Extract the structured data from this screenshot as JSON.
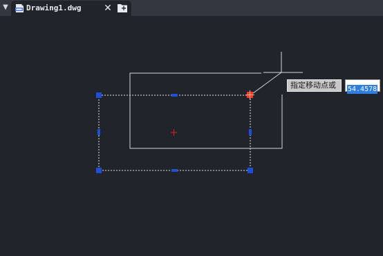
{
  "tabs": {
    "menu_glyph": "▼",
    "active": {
      "title": "Drawing1.dwg",
      "file_icon": "dwg-file-icon",
      "close_glyph": "✕"
    },
    "new_tab_icon": "new-tab-icon"
  },
  "dynamic_input": {
    "prompt": "指定移动点或",
    "value": "54.4578"
  },
  "colors": {
    "canvas_background": "#21242b",
    "tabbar_background": "#33373f",
    "grip": "#1f4fd6",
    "hot_grip": "#ff3b1f",
    "geometry": "#d9d9d9",
    "center_mark": "#e02020",
    "value_highlight": "#2f7de0"
  }
}
